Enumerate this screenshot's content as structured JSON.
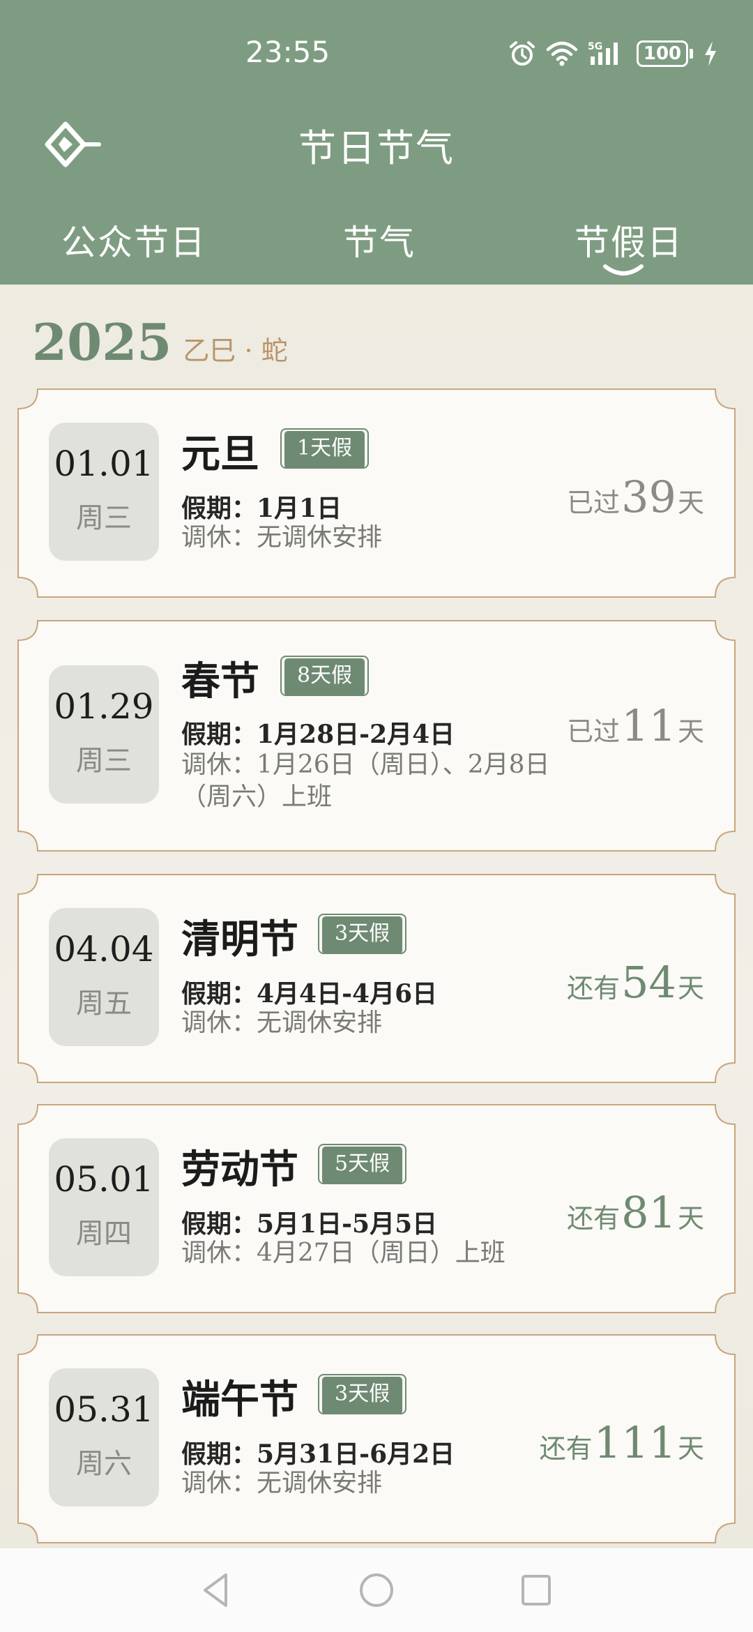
{
  "status_bar": {
    "time": "23:55",
    "battery": "100"
  },
  "app_bar": {
    "title": "节日节气",
    "logo_icon": "diamond-logo-icon"
  },
  "tabs": [
    {
      "label": "公众节日",
      "active": false
    },
    {
      "label": "节气",
      "active": false
    },
    {
      "label": "节假日",
      "active": true
    }
  ],
  "year_header": {
    "year": "2025",
    "ganzhi": "乙巳 · 蛇"
  },
  "holidays": [
    {
      "date": "01.01",
      "weekday": "周三",
      "name": "元旦",
      "badge": "1天假",
      "holiday": "假期：1月1日",
      "adjust": "调休：无调休安排",
      "countdown_prefix": "已过",
      "countdown_num": "39",
      "countdown_suffix": "天",
      "status": "past"
    },
    {
      "date": "01.29",
      "weekday": "周三",
      "name": "春节",
      "badge": "8天假",
      "holiday": "假期：1月28日-2月4日",
      "adjust": "调休：1月26日（周日）、2月8日（周六）上班",
      "countdown_prefix": "已过",
      "countdown_num": "11",
      "countdown_suffix": "天",
      "status": "past"
    },
    {
      "date": "04.04",
      "weekday": "周五",
      "name": "清明节",
      "badge": "3天假",
      "holiday": "假期：4月4日-4月6日",
      "adjust": "调休：无调休安排",
      "countdown_prefix": "还有",
      "countdown_num": "54",
      "countdown_suffix": "天",
      "status": "future"
    },
    {
      "date": "05.01",
      "weekday": "周四",
      "name": "劳动节",
      "badge": "5天假",
      "holiday": "假期：5月1日-5月5日",
      "adjust": "调休：4月27日（周日）上班",
      "countdown_prefix": "还有",
      "countdown_num": "81",
      "countdown_suffix": "天",
      "status": "future"
    },
    {
      "date": "05.31",
      "weekday": "周六",
      "name": "端午节",
      "badge": "3天假",
      "holiday": "假期：5月31日-6月2日",
      "adjust": "调休：无调休安排",
      "countdown_prefix": "还有",
      "countdown_num": "111",
      "countdown_suffix": "天",
      "status": "future"
    }
  ],
  "colors": {
    "header_bg": "#7e9c81",
    "accent": "#6f8a72",
    "page_bg": "#efece3",
    "card_border": "#c9a57c",
    "past_text": "#8c8a83",
    "ganzhi_text": "#b8956a"
  },
  "nav_bar": {
    "back_icon": "back-triangle-icon",
    "home_icon": "home-circle-icon",
    "recents_icon": "recents-square-icon"
  }
}
